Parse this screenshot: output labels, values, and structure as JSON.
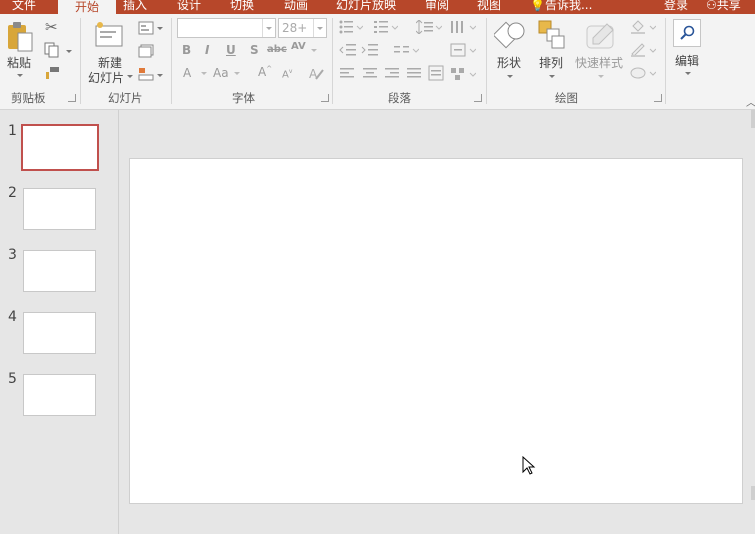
{
  "tabs": [
    {
      "label": "文件",
      "active": false
    },
    {
      "label": "开始",
      "active": true
    },
    {
      "label": "插入",
      "active": false
    },
    {
      "label": "设计",
      "active": false
    },
    {
      "label": "切换",
      "active": false
    },
    {
      "label": "动画",
      "active": false
    },
    {
      "label": "幻灯片放映",
      "active": false
    },
    {
      "label": "审阅",
      "active": false
    },
    {
      "label": "视图",
      "active": false
    },
    {
      "label": "告诉我...",
      "active": false
    }
  ],
  "account": {
    "login": "登录",
    "share": "共享"
  },
  "groups": {
    "clipboard": {
      "label": "剪贴板",
      "paste": "粘贴"
    },
    "slides": {
      "label": "幻灯片",
      "new_slide_line1": "新建",
      "new_slide_line2": "幻灯片"
    },
    "font": {
      "label": "字体",
      "font_name": "",
      "font_size": "28+"
    },
    "paragraph": {
      "label": "段落"
    },
    "drawing": {
      "label": "绘图",
      "shape": "形状",
      "arrange": "排列",
      "quick_styles": "快速样式"
    },
    "editing": {
      "label": "编辑"
    }
  },
  "thumbnails": [
    {
      "num": "1",
      "selected": true
    },
    {
      "num": "2",
      "selected": false
    },
    {
      "num": "3",
      "selected": false
    },
    {
      "num": "4",
      "selected": false
    },
    {
      "num": "5",
      "selected": false
    }
  ],
  "colors": {
    "accent": "#b7472a",
    "ribbon": "#f3f3f3",
    "workspace": "#e6e6e6",
    "selection": "#c0504d"
  }
}
